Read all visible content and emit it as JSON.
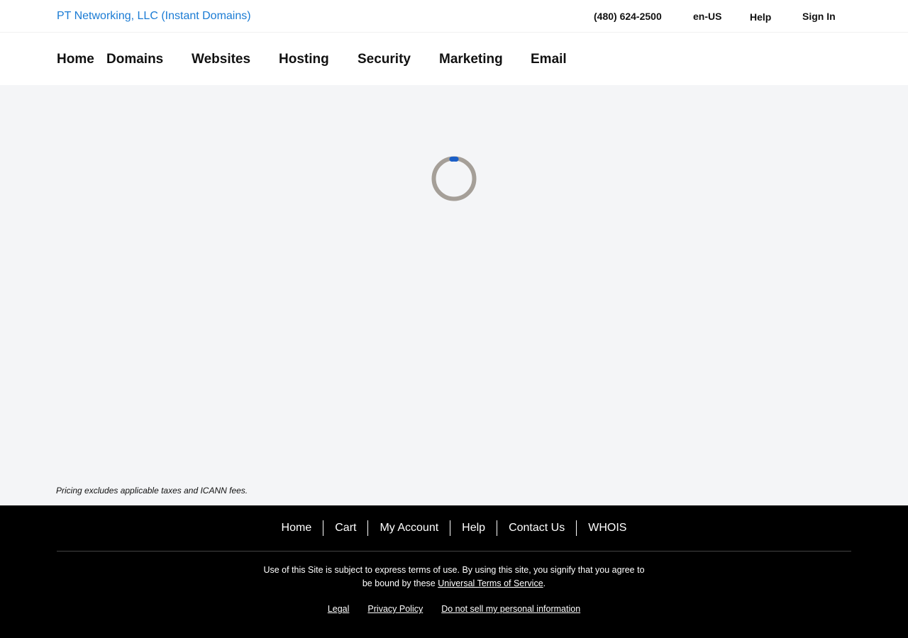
{
  "colors": {
    "brand_link": "#1a7bd4",
    "page_background": "#f4f5f7",
    "header_background": "#ffffff",
    "footer_background": "#000000",
    "spinner_track": "#a59f98",
    "spinner_indicator": "#1b5fc7"
  },
  "header": {
    "brand": "PT Networking, LLC (Instant Domains)",
    "phone": "(480) 624-2500",
    "locale": "en-US",
    "help": "Help",
    "sign_in": "Sign In"
  },
  "nav": {
    "items": [
      {
        "label": "Home"
      },
      {
        "label": "Domains"
      },
      {
        "label": "Websites"
      },
      {
        "label": "Hosting"
      },
      {
        "label": "Security"
      },
      {
        "label": "Marketing"
      },
      {
        "label": "Email"
      }
    ]
  },
  "main": {
    "loading_icon": "spinner-icon",
    "pricing_note": "Pricing excludes applicable taxes and ICANN fees."
  },
  "footer": {
    "links": [
      {
        "label": "Home"
      },
      {
        "label": "Cart"
      },
      {
        "label": "My Account"
      },
      {
        "label": "Help"
      },
      {
        "label": "Contact Us"
      },
      {
        "label": "WHOIS"
      }
    ],
    "terms_prefix": "Use of this Site is subject to express terms of use. By using this site, you signify that you agree to be bound by these",
    "terms_link": "Universal Terms of Service",
    "terms_suffix": ".",
    "legal_links": [
      {
        "label": "Legal"
      },
      {
        "label": "Privacy Policy"
      },
      {
        "label": "Do not sell my personal information"
      }
    ]
  }
}
